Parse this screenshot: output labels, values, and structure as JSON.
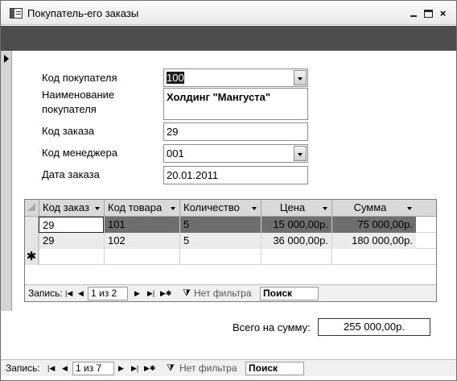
{
  "window": {
    "title": "Покупатель-его заказы"
  },
  "form": {
    "customer_code_label": "Код покупателя",
    "customer_code_value": "100",
    "customer_name_label_line1": "Наименование",
    "customer_name_label_line2": "покупателя",
    "customer_name_value": "Холдинг \"Мангуста\"",
    "order_code_label": "Код заказа",
    "order_code_value": "29",
    "manager_code_label": "Код менеджера",
    "manager_code_value": "001",
    "order_date_label": "Дата заказа",
    "order_date_value": "20.01.2011"
  },
  "subform": {
    "columns": [
      "Код заказ",
      "Код товара",
      "Количество",
      "Цена",
      "Сумма"
    ],
    "rows": [
      [
        "29",
        "101",
        "5",
        "15 000,00р.",
        "75 000,00р."
      ],
      [
        "29",
        "102",
        "5",
        "36 000,00р.",
        "180 000,00р."
      ]
    ],
    "new_row_marker": "✱",
    "nav": {
      "label": "Запись:",
      "position": "1 из 2",
      "filter_label": "Нет фильтра",
      "search_placeholder": "Поиск"
    }
  },
  "totals": {
    "label": "Всего на сумму:",
    "value": "255 000,00р."
  },
  "main_nav": {
    "label": "Запись:",
    "position": "1 из 7",
    "filter_label": "Нет фильтра",
    "search_placeholder": "Поиск"
  }
}
